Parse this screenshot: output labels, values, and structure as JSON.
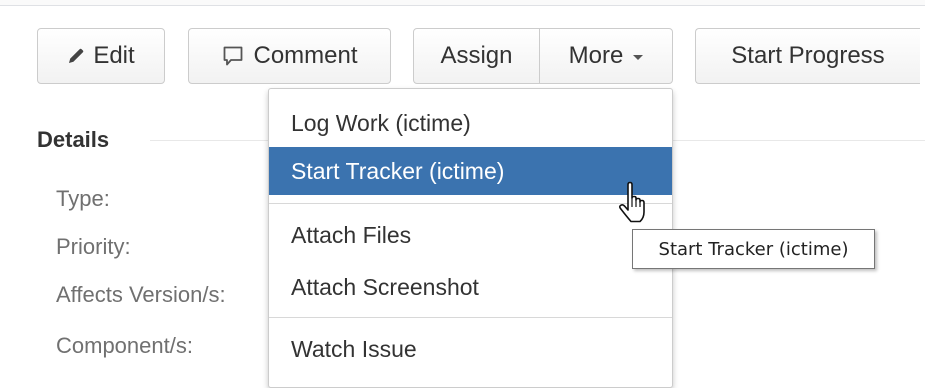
{
  "toolbar": {
    "edit_label": "Edit",
    "comment_label": "Comment",
    "assign_label": "Assign",
    "more_label": "More",
    "start_progress_label": "Start Progress",
    "edit_icon": "pencil-icon",
    "comment_icon": "speech-bubble-icon",
    "more_icon": "caret-down-icon"
  },
  "details": {
    "heading": "Details",
    "fields": [
      {
        "label": "Type:"
      },
      {
        "label": "Priority:"
      },
      {
        "label": "Affects Version/s:"
      },
      {
        "label": "Component/s:"
      }
    ]
  },
  "more_menu": {
    "items": [
      {
        "label": "Log Work (ictime)"
      },
      {
        "label": "Start Tracker (ictime)",
        "highlighted": true
      },
      {
        "label": "Attach Files"
      },
      {
        "label": "Attach Screenshot"
      },
      {
        "label": "Watch Issue"
      }
    ],
    "highlight_color": "#3b73af"
  },
  "tooltip": {
    "text": "Start Tracker (ictime)"
  },
  "cursor": {
    "icon": "hand-pointer-icon"
  }
}
